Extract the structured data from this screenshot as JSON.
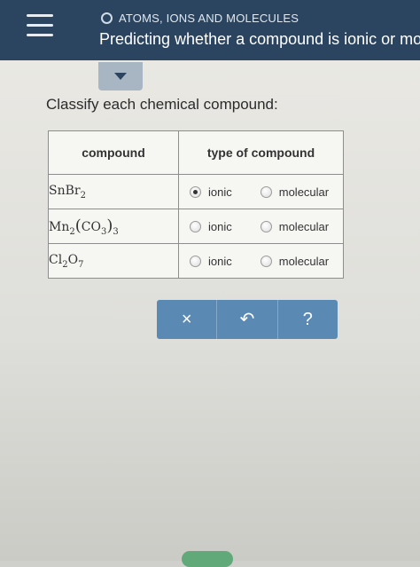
{
  "header": {
    "breadcrumb": "ATOMS, IONS AND MOLECULES",
    "title": "Predicting whether a compound is ionic or molecular",
    "menu_icon": "hamburger-menu-icon",
    "colors": {
      "bar": "#2b4560",
      "accent": "#5a89b4"
    }
  },
  "main": {
    "prompt": "Classify each chemical compound:",
    "table": {
      "headers": {
        "compound": "compound",
        "type": "type of compound"
      },
      "options": {
        "ionic": "ionic",
        "molecular": "molecular"
      },
      "rows": [
        {
          "formula": {
            "a": "SnBr",
            "a_sub": "2"
          },
          "selected": "ionic"
        },
        {
          "formula": {
            "a": "Mn",
            "a_sub": "2",
            "b": "CO",
            "b_sub": "3",
            "outer_sub": "3"
          },
          "selected": null
        },
        {
          "formula": {
            "a": "Cl",
            "a_sub": "2",
            "b": "O",
            "b_sub": "7"
          },
          "selected": null
        }
      ]
    },
    "toolbar": {
      "clear_glyph": "×",
      "undo_glyph": "↶",
      "help_glyph": "?"
    }
  }
}
